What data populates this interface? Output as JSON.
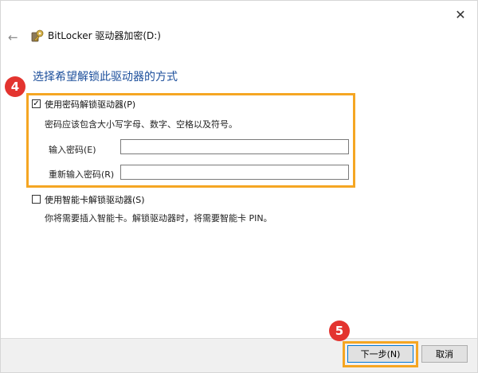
{
  "window": {
    "title": "BitLocker 驱动器加密(D:)",
    "close_glyph": "✕",
    "back_glyph": "←",
    "app_icon": "bitlocker-key-icon"
  },
  "page": {
    "heading": "选择希望解锁此驱动器的方式"
  },
  "password_option": {
    "label": "使用密码解锁驱动器(P)",
    "checked": true,
    "check_glyph": "✓",
    "description": "密码应该包含大小写字母、数字、空格以及符号。",
    "enter_label": "输入密码(E)",
    "enter_value": "",
    "reenter_label": "重新输入密码(R)",
    "reenter_value": ""
  },
  "smartcard_option": {
    "label": "使用智能卡解锁驱动器(S)",
    "checked": false,
    "description": "你将需要插入智能卡。解锁驱动器时，将需要智能卡 PIN。"
  },
  "footer": {
    "next_label": "下一步(N)",
    "cancel_label": "取消"
  },
  "annotations": {
    "step4": "4",
    "step5": "5",
    "badge_color": "#e3342f",
    "highlight_color": "#f5a623"
  }
}
